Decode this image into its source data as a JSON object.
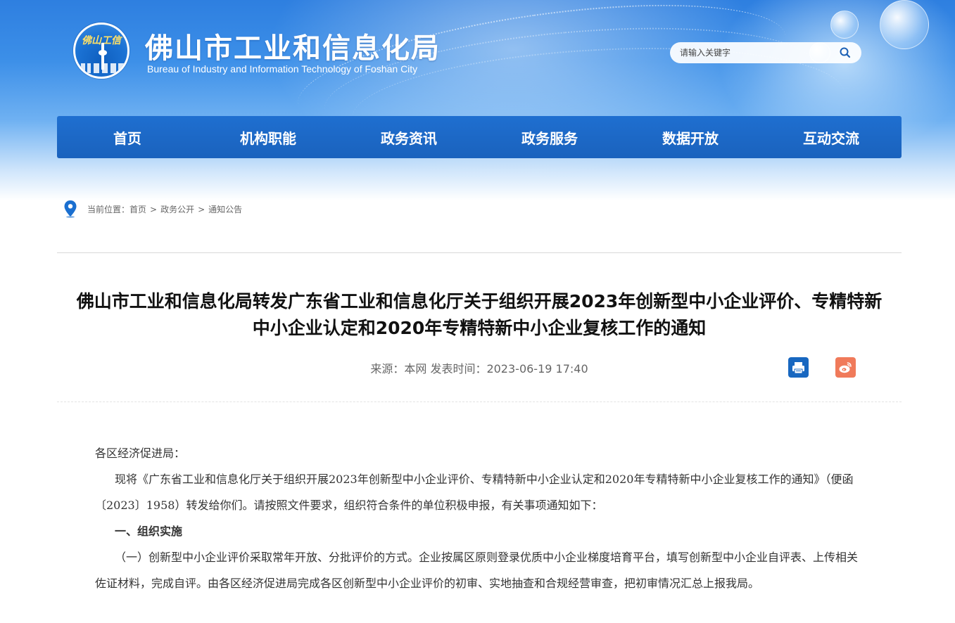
{
  "header": {
    "logo_text": "佛山工信",
    "title": "佛山市工业和信息化局",
    "subtitle": "Bureau of Industry and Information Technology of Foshan City",
    "search": {
      "placeholder": "请输入关键字"
    }
  },
  "nav": {
    "items": [
      {
        "label": "首页"
      },
      {
        "label": "机构职能"
      },
      {
        "label": "政务资讯"
      },
      {
        "label": "政务服务"
      },
      {
        "label": "数据开放"
      },
      {
        "label": "互动交流"
      }
    ]
  },
  "breadcrumb": {
    "prefix": "当前位置：",
    "items": [
      "首页",
      "政务公开",
      "通知公告"
    ],
    "separator": ">"
  },
  "article": {
    "title_line1": "佛山市工业和信息化局转发广东省工业和信息化厅关于组织开展2023年创新型中小企业评价、专精特新",
    "title_line2": "中小企业认定和2020年专精特新中小企业复核工作的通知",
    "meta": "来源：本网 发表时间：2023-06-19 17:40",
    "share_icons": [
      "print-icon",
      "weibo-icon"
    ],
    "body": {
      "salutation": "各区经济促进局：",
      "para1": "现将《广东省工业和信息化厅关于组织开展2023年创新型中小企业评价、专精特新中小企业认定和2020年专精特新中小企业复核工作的通知》（便函〔2023〕1958）转发给你们。请按照文件要求，组织符合条件的单位积极申报，有关事项通知如下：",
      "heading1": "一、组织实施",
      "para2": "（一）创新型中小企业评价采取常年开放、分批评价的方式。企业按属区原则登录优质中小企业梯度培育平台，填写创新型中小企业自评表、上传相关佐证材料，完成自评。由各区经济促进局完成各区创新型中小企业评价的初审、实地抽查和合规经营审查，把初审情况汇总上报我局。"
    }
  },
  "colors": {
    "nav_bg": "#1f6fd0",
    "print_btn": "#1867c0",
    "weibo_btn": "#f07a5a",
    "pin": "#1a6fd0"
  }
}
